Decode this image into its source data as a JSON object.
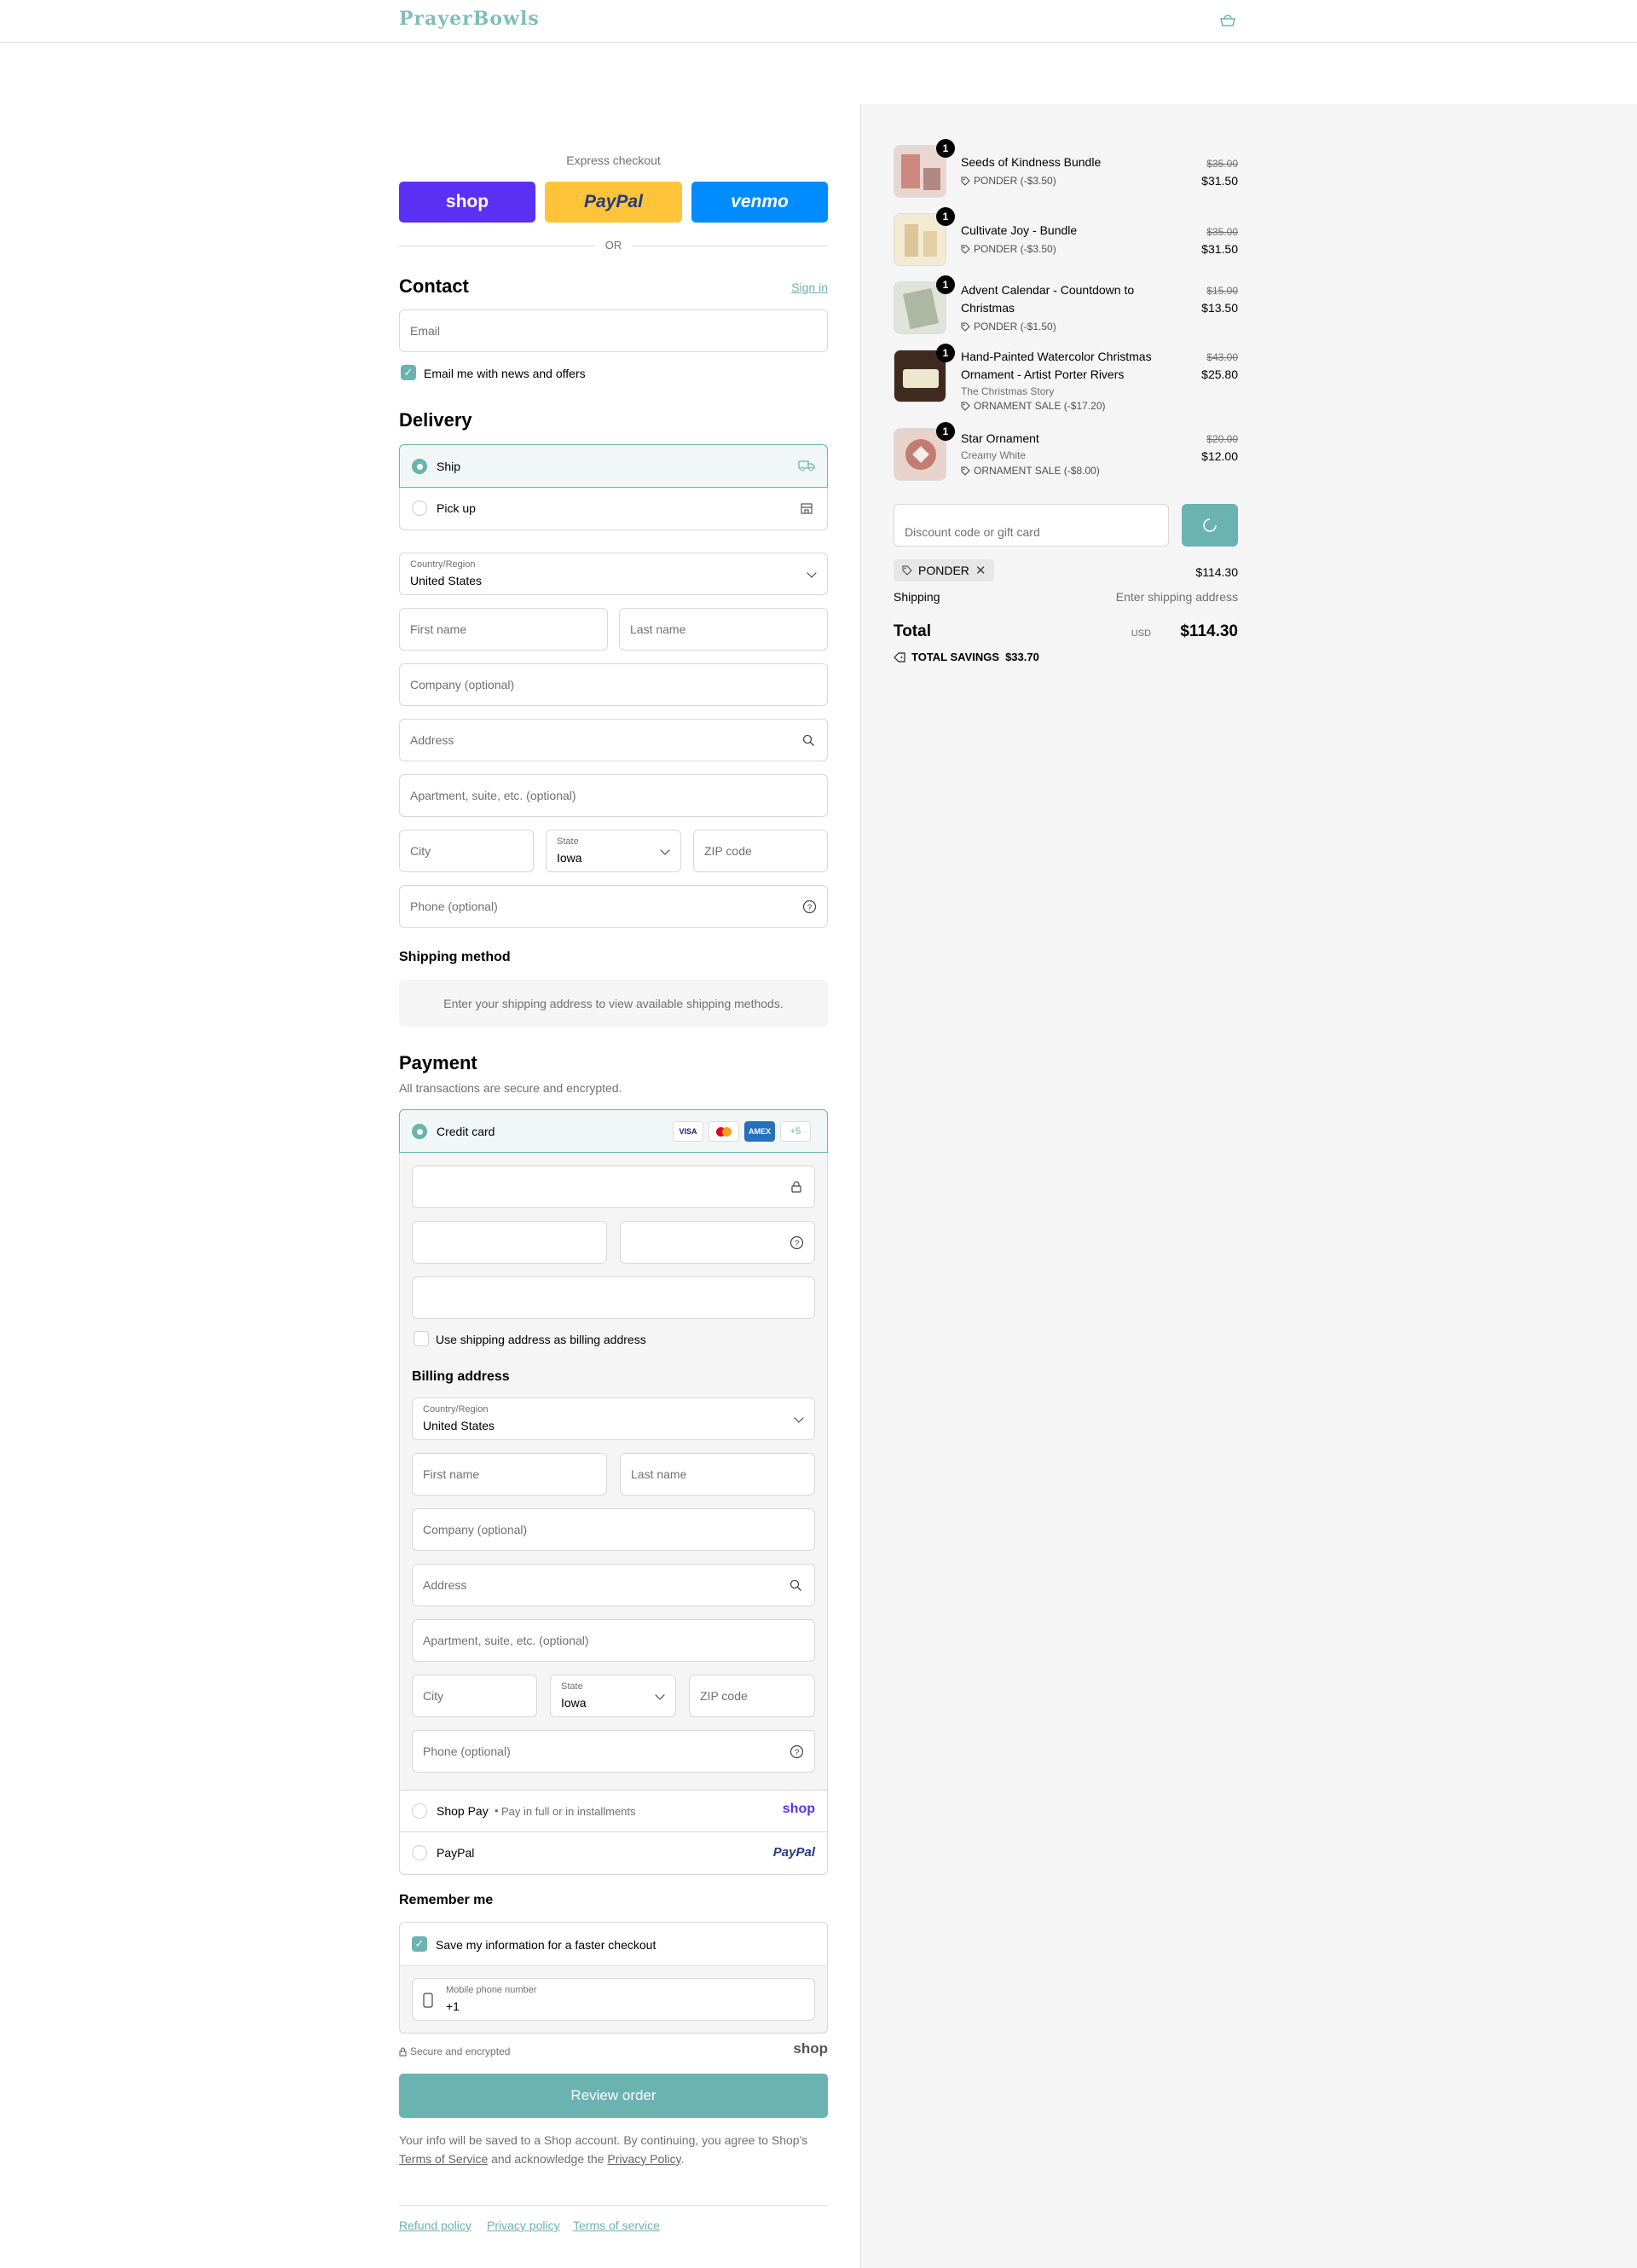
{
  "header": {
    "logo": "PrayerBowls",
    "cart_icon": "bag-icon"
  },
  "express": {
    "label": "Express checkout",
    "shop": "shop",
    "paypal": "PayPal",
    "venmo": "venmo",
    "or": "OR"
  },
  "contact": {
    "title": "Contact",
    "sign_in": "Sign in",
    "email_placeholder": "Email",
    "news_label": "Email me with news and offers"
  },
  "delivery": {
    "title": "Delivery",
    "ship": "Ship",
    "pickup": "Pick up",
    "country_label": "Country/Region",
    "country": "United States",
    "first_name": "First name",
    "last_name": "Last name",
    "company": "Company (optional)",
    "address": "Address",
    "apartment": "Apartment, suite, etc. (optional)",
    "city": "City",
    "state_label": "State",
    "state": "Iowa",
    "zip": "ZIP code",
    "phone": "Phone (optional)"
  },
  "shipping_method": {
    "title": "Shipping method",
    "message": "Enter your shipping address to view available shipping methods."
  },
  "payment": {
    "title": "Payment",
    "subtitle": "All transactions are secure and encrypted.",
    "credit_card": "Credit card",
    "visa": "VISA",
    "amex": "AMEX",
    "more": "+5",
    "use_shipping": "Use shipping address as billing address",
    "billing_title": "Billing address",
    "shop_pay": "Shop Pay",
    "shop_pay_sub": "Pay in full or in installments",
    "shop_pay_logo": "shop",
    "paypal": "PayPal",
    "paypal_logo": "PayPal"
  },
  "billing": {
    "country_label": "Country/Region",
    "country": "United States",
    "first_name": "First name",
    "last_name": "Last name",
    "company": "Company (optional)",
    "address": "Address",
    "apartment": "Apartment, suite, etc. (optional)",
    "city": "City",
    "state_label": "State",
    "state": "Iowa",
    "zip": "ZIP code",
    "phone": "Phone (optional)"
  },
  "remember": {
    "title": "Remember me",
    "save_label": "Save my information for a faster checkout",
    "mobile_label": "Mobile phone number",
    "mobile_value": "+1"
  },
  "footer_checkout": {
    "secure": "Secure and encrypted",
    "shop_logo": "shop",
    "review_button": "Review order",
    "legal_1": "Your info will be saved to a Shop account. By continuing, you agree to Shop's",
    "terms": "Terms of Service",
    "legal_2": "and acknowledge the",
    "privacy": "Privacy Policy",
    "legal_end": "."
  },
  "footer_links": {
    "refund": "Refund policy",
    "privacy": "Privacy policy",
    "terms": "Terms of service"
  },
  "summary": {
    "items": [
      {
        "qty": "1",
        "name": "Seeds of Kindness Bundle",
        "sub": "",
        "discount": "PONDER (-$3.50)",
        "old": "$35.00",
        "price": "$31.50",
        "thumb": "#c9a49a"
      },
      {
        "qty": "1",
        "name": "Cultivate Joy - Bundle",
        "sub": "",
        "discount": "PONDER (-$3.50)",
        "old": "$35.00",
        "price": "$31.50",
        "thumb": "#e8d9b5"
      },
      {
        "qty": "1",
        "name": "Advent Calendar - Countdown to Christmas",
        "sub": "",
        "discount": "PONDER (-$1.50)",
        "old": "$15.00",
        "price": "$13.50",
        "thumb": "#a9b3a0"
      },
      {
        "qty": "1",
        "name": "Hand-Painted Watercolor Christmas Ornament - Artist Porter Rivers",
        "sub": "The Christmas Story",
        "discount": "ORNAMENT SALE (-$17.20)",
        "old": "$43.00",
        "price": "$25.80",
        "thumb": "#4a3226"
      },
      {
        "qty": "1",
        "name": "Star Ornament",
        "sub": "Creamy White",
        "discount": "ORNAMENT SALE (-$8.00)",
        "old": "$20.00",
        "price": "$12.00",
        "thumb": "#b97a6c"
      }
    ],
    "discount_placeholder": "Discount code or gift card",
    "code_tag": "PONDER",
    "subtotal": "$114.30",
    "shipping_label": "Shipping",
    "shipping_value": "Enter shipping address",
    "total_label": "Total",
    "currency": "USD",
    "total": "$114.30",
    "savings_label": "TOTAL SAVINGS",
    "savings": "$33.70"
  }
}
